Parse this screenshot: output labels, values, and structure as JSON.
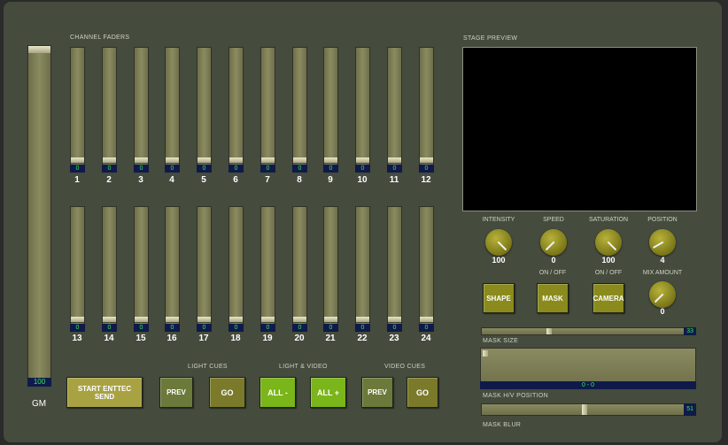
{
  "sections": {
    "channel_faders": "CHANNEL FADERS",
    "stage_preview": "STAGE PREVIEW",
    "light_cues": "LIGHT CUES",
    "light_video": "LIGHT & VIDEO",
    "video_cues": "VIDEO CUES"
  },
  "gm": {
    "label": "GM",
    "value": "100",
    "level": 1.0
  },
  "channels": [
    {
      "num": "1",
      "value": "0"
    },
    {
      "num": "2",
      "value": "0"
    },
    {
      "num": "3",
      "value": "0"
    },
    {
      "num": "4",
      "value": "0"
    },
    {
      "num": "5",
      "value": "0"
    },
    {
      "num": "6",
      "value": "0"
    },
    {
      "num": "7",
      "value": "0"
    },
    {
      "num": "8",
      "value": "0"
    },
    {
      "num": "9",
      "value": "0"
    },
    {
      "num": "10",
      "value": "0"
    },
    {
      "num": "11",
      "value": "0"
    },
    {
      "num": "12",
      "value": "0"
    },
    {
      "num": "13",
      "value": "0"
    },
    {
      "num": "14",
      "value": "0"
    },
    {
      "num": "15",
      "value": "0"
    },
    {
      "num": "16",
      "value": "0"
    },
    {
      "num": "17",
      "value": "0"
    },
    {
      "num": "18",
      "value": "0"
    },
    {
      "num": "19",
      "value": "0"
    },
    {
      "num": "20",
      "value": "0"
    },
    {
      "num": "21",
      "value": "0"
    },
    {
      "num": "22",
      "value": "0"
    },
    {
      "num": "23",
      "value": "0"
    },
    {
      "num": "24",
      "value": "0"
    }
  ],
  "buttons": {
    "start_enttec": "START ENTTEC SEND",
    "light_prev": "PREV",
    "light_go": "GO",
    "all_minus": "ALL -",
    "all_plus": "ALL +",
    "video_prev": "PREV",
    "video_go": "GO",
    "shape": "SHAPE",
    "mask": "MASK",
    "camera": "CAMERA"
  },
  "toggles": {
    "mask_onoff": "ON / OFF",
    "camera_onoff": "ON / OFF"
  },
  "knobs": {
    "intensity": {
      "label": "INTENSITY",
      "value": "100"
    },
    "speed": {
      "label": "SPEED",
      "value": "0"
    },
    "saturation": {
      "label": "SATURATION",
      "value": "100"
    },
    "position": {
      "label": "POSITION",
      "value": "4"
    },
    "mix_amount": {
      "label": "MIX AMOUNT",
      "value": "0"
    }
  },
  "sliders": {
    "mask_size": {
      "label": "MASK SIZE",
      "value": "33",
      "level": 0.33
    },
    "mask_hv": {
      "label": "MASK H/V POSITION",
      "value": "0 - 0"
    },
    "mask_blur": {
      "label": "MASK BLUR",
      "value": "51",
      "level": 0.51
    }
  },
  "colors": {
    "panel": "#454b3d",
    "value_bg": "#0f1a4a",
    "value_text": "#37e85a",
    "btn_start": "#a8a243",
    "btn_cue": "#6b7a3a",
    "btn_go": "#7a7a2a",
    "btn_all": "#7ab51a",
    "btn_toggle": "#8a8b1c"
  }
}
